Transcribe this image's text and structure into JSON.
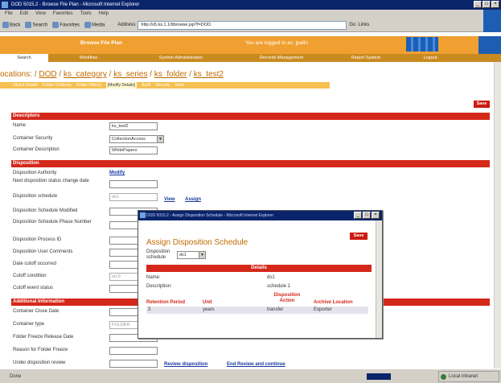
{
  "window": {
    "title": "DOD 5015.2 - Browse File Plan - Microsoft Internet Explorer",
    "menu": [
      "File",
      "Edit",
      "View",
      "Favorites",
      "Tools",
      "Help"
    ],
    "toolbar": [
      "Back",
      "Search",
      "Favorites",
      "Media"
    ],
    "address_label": "Address",
    "address_url": "http://s5.ks.1.1/ttbrowse.jsp?f=DOD",
    "go_label": "Go",
    "links_label": "Links"
  },
  "header": {
    "page_title": "Browse File Plan",
    "logged_in": "You are logged in as: jpalin"
  },
  "nav": {
    "items": [
      "Search",
      "Workflow",
      "System Administration",
      "Records Management",
      "Report System",
      "Logout"
    ]
  },
  "breadcrumb": {
    "prefix": "ocations: ",
    "items": [
      "DOD",
      "ks_category",
      "ks_series",
      "ks_folder",
      "ks_test2"
    ]
  },
  "subtabs": [
    "Object Details",
    "Folder Contents",
    "Folder History",
    "[Modify Details]",
    "Audit",
    "Security",
    "Stats"
  ],
  "save_label": "Save",
  "descriptors": {
    "heading": "Descriptors",
    "name_label": "Name",
    "name_value": "ks_test2",
    "security_label": "Container Security",
    "security_value": "CollectionAccess",
    "description_label": "Container Description",
    "description_value": "WhitePapers"
  },
  "disposition": {
    "heading": "Disposition",
    "authority_label": "Disposition Authority",
    "modify_link": "Modify",
    "next_change_label": "Next disposition status change date",
    "schedule_label": "Disposition schedule",
    "schedule_value": "ds1",
    "view_link": "View",
    "assign_link": "Assign",
    "modified_label": "Disposition Schedule Modified",
    "phase_label": "Disposition Schedule Phase Number",
    "process_label": "Disposition Process ID",
    "comments_label": "Disposition User Comments",
    "cutoff_date_label": "Date cutoff occurred",
    "cutoff_cond_label": "Cutoff condition",
    "cutoff_cond_value": "on:0",
    "cutoff_event_label": "Cutoff event status"
  },
  "additional": {
    "heading": "Additional Information",
    "close_label": "Container Close Date",
    "type_label": "Container type",
    "type_value": "FOLDER",
    "freeze_release_label": "Folder Freeze Release Date",
    "freeze_reason_label": "Reason for Folder Freeze",
    "under_review_label": "Under disposition review"
  },
  "footer_links": {
    "review": "Review disposition",
    "end_review": "End Review and continue"
  },
  "dialog": {
    "titlebar": "DOD 5015.2 - Assign Disposition Schedule - Microsoft Internet Explorer",
    "title": "Assign Disposition Schedule",
    "save_label": "Save",
    "schedule_label": "Disposition schedule",
    "schedule_value": "ds1",
    "details_heading": "Details",
    "name_label": "Name:",
    "name_value": "ds1",
    "description_label": "Description:",
    "description_value": "schedule 1",
    "columns": [
      "Retention Period",
      "Unit",
      "Disposition Action",
      "Archive Location"
    ],
    "rows": [
      [
        "3",
        "years",
        "transfer",
        "Exporter"
      ]
    ]
  },
  "status": {
    "done": "Done",
    "zone": "Local intranet"
  }
}
